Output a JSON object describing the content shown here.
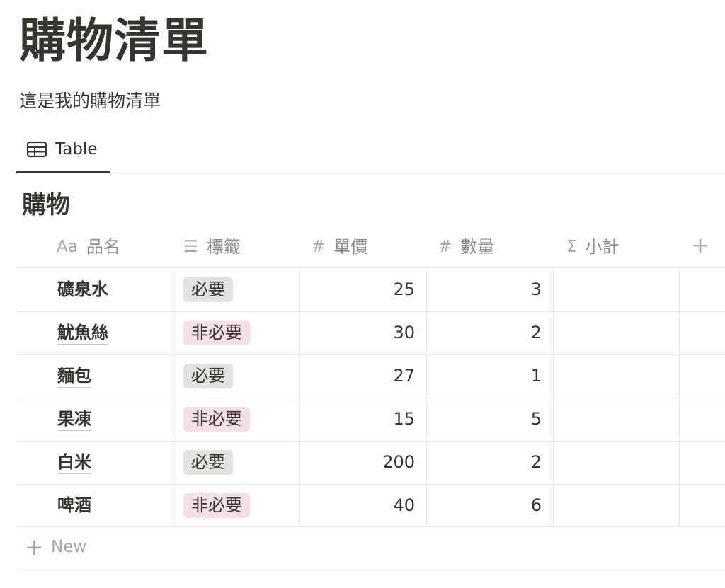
{
  "page": {
    "title": "購物清單",
    "description": "這是我的購物清單"
  },
  "views": {
    "active_tab": {
      "label": "Table",
      "icon": "table-icon"
    }
  },
  "database": {
    "title": "購物",
    "columns": [
      {
        "label": "品名",
        "icon": "Aa",
        "icon_name": "text-property-icon"
      },
      {
        "label": "標籤",
        "icon": "☰",
        "icon_name": "multi-select-property-icon"
      },
      {
        "label": "單價",
        "icon": "#",
        "icon_name": "number-property-icon"
      },
      {
        "label": "數量",
        "icon": "#",
        "icon_name": "number-property-icon"
      },
      {
        "label": "小計",
        "icon": "Σ",
        "icon_name": "formula-property-icon"
      }
    ],
    "add_column_icon": "+",
    "rows": [
      {
        "name": "礦泉水",
        "tag": "必要",
        "tag_color": "#e3e2e0",
        "price": "25",
        "qty": "3",
        "subtotal": ""
      },
      {
        "name": "魷魚絲",
        "tag": "非必要",
        "tag_color": "#f5e0e9",
        "price": "30",
        "qty": "2",
        "subtotal": ""
      },
      {
        "name": "麵包",
        "tag": "必要",
        "tag_color": "#e3e2e0",
        "price": "27",
        "qty": "1",
        "subtotal": ""
      },
      {
        "name": "果凍",
        "tag": "非必要",
        "tag_color": "#f5e0e9",
        "price": "15",
        "qty": "5",
        "subtotal": ""
      },
      {
        "name": "白米",
        "tag": "必要",
        "tag_color": "#e3e2e0",
        "price": "200",
        "qty": "2",
        "subtotal": ""
      },
      {
        "name": "啤酒",
        "tag": "非必要",
        "tag_color": "#f5e0e9",
        "price": "40",
        "qty": "6",
        "subtotal": ""
      }
    ],
    "new_row": {
      "icon": "+",
      "label": "New"
    }
  }
}
